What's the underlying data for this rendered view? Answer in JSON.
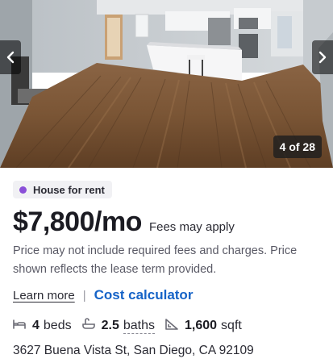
{
  "gallery": {
    "counter_text": "4 of 28",
    "prev_icon": "chevron-left-icon",
    "next_icon": "chevron-right-icon"
  },
  "listing": {
    "badge_text": "House for rent",
    "badge_dot_color": "#8a4fd8",
    "price": "$7,800/mo",
    "fees_note": "Fees may apply",
    "disclaimer": "Price may not include required fees and charges. Price shown reflects the lease term provided.",
    "learn_more": "Learn more",
    "separator": "|",
    "cost_calculator": "Cost calculator",
    "link_color": "#1563c7",
    "beds_value": "4",
    "beds_unit": "beds",
    "baths_value": "2.5",
    "baths_unit": "baths",
    "sqft_value": "1,600",
    "sqft_unit": "sqft",
    "address": "3627 Buena Vista St, San Diego, CA 92109"
  }
}
